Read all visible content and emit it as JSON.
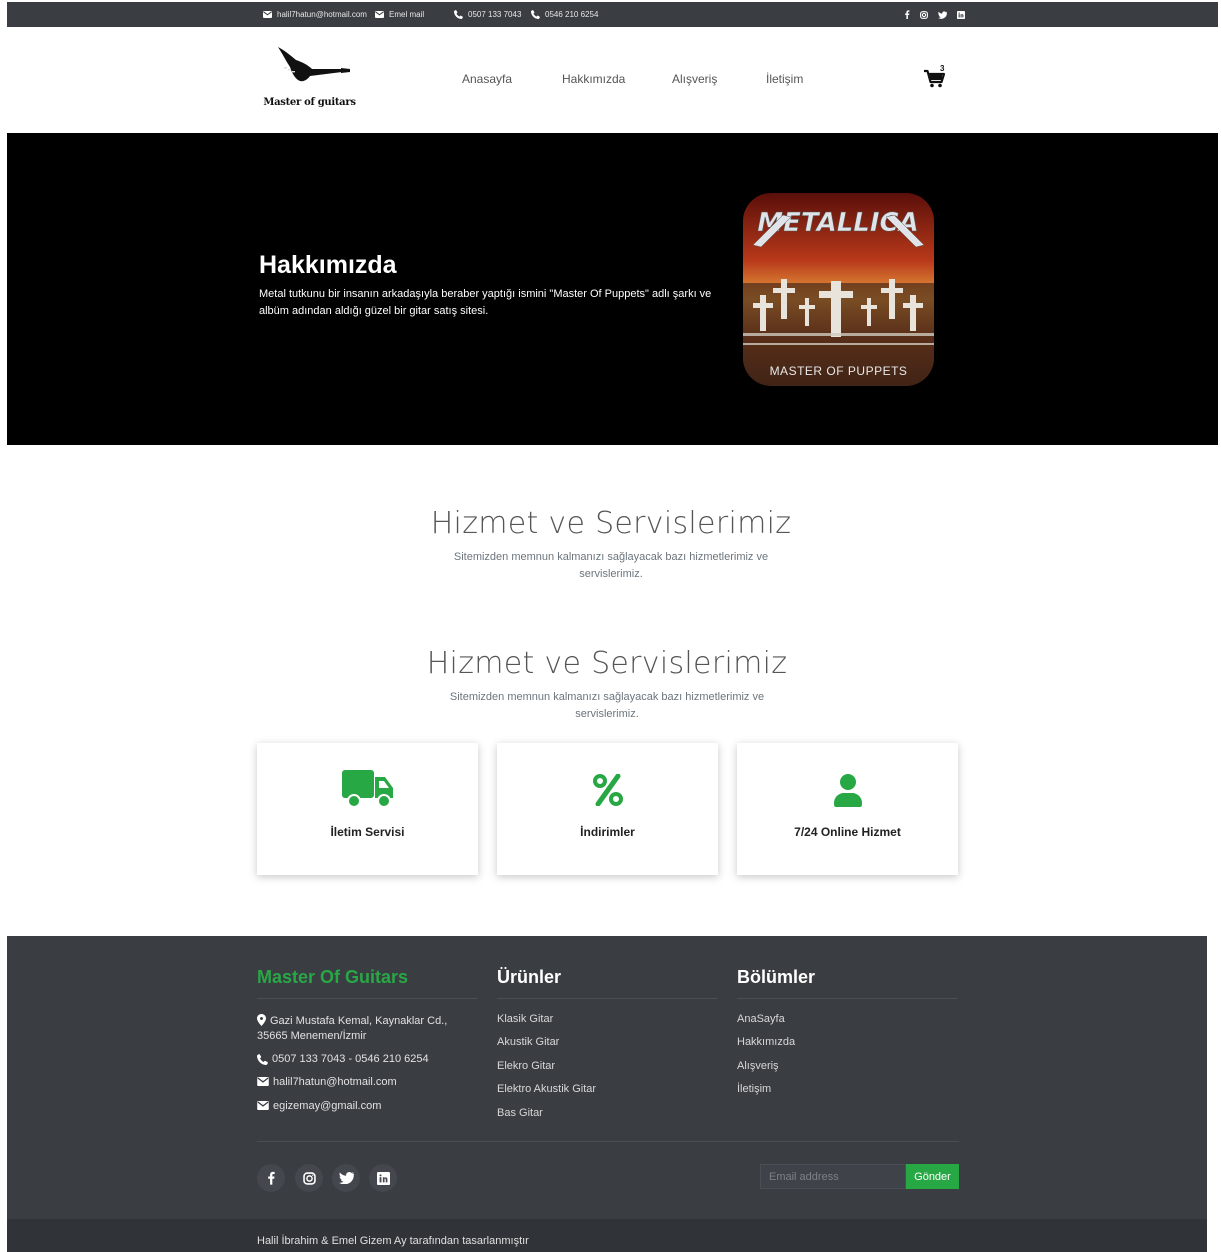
{
  "topbar": {
    "email1": "halil7hatun@hotmail.com",
    "email2": "Emel mail",
    "phone1": "0507 133 7043",
    "phone2": "0546 210 6254",
    "social_icons": [
      "facebook-icon",
      "instagram-icon",
      "twitter-icon",
      "linkedin-icon"
    ]
  },
  "header": {
    "logo_text": "Master of guitars",
    "nav": [
      "Anasayfa",
      "Hakkımızda",
      "Alışveriş",
      "İletişim"
    ],
    "cart_count": "3"
  },
  "hero": {
    "title": "Hakkımızda",
    "text": "Metal tutkunu bir insanın arkadaşıyla beraber yaptığı ismini \"Master Of Puppets\" adlı şarkı ve albüm adından aldığı güzel bir gitar satış sitesi.",
    "album_logo": "METALLICA",
    "album_caption": "MASTER OF PUPPETS"
  },
  "services1": {
    "title": "Hizmet ve Servislerimiz",
    "subtitle": "Sitemizden memnun kalmanızı sağlayacak bazı hizmetlerimiz ve servislerimiz."
  },
  "services2": {
    "title": "Hizmet ve Servislerimiz",
    "subtitle": "Sitemizden memnun kalmanızı sağlayacak bazı hizmetlerimiz ve servislerimiz.",
    "cards": [
      {
        "icon": "truck-icon",
        "label": "İletim Servisi"
      },
      {
        "icon": "percent-icon",
        "label": "İndirimler"
      },
      {
        "icon": "user-icon",
        "label": "7/24 Online Hizmet"
      }
    ],
    "accent": "#28a745"
  },
  "footer": {
    "brand": "Master Of Guitars",
    "address": "Gazi Mustafa Kemal, Kaynaklar Cd., 35665 Menemen/İzmir",
    "address_line1": "Gazi Mustafa Kemal, Kaynaklar Cd.,",
    "address_line2": "35665 Menemen/İzmir",
    "phones": "0507 133 7043 - 0546 210 6254",
    "email1": "halil7hatun@hotmail.com",
    "email2": "egizemay@gmail.com",
    "products_title": "Ürünler",
    "products": [
      "Klasik Gitar",
      "Akustik Gitar",
      "Elekro Gitar",
      "Elektro Akustik Gitar",
      "Bas Gitar"
    ],
    "sections_title": "Bölümler",
    "sections": [
      "AnaSayfa",
      "Hakkımızda",
      "Alışveriş",
      "İletişim"
    ],
    "email_placeholder": "Email address",
    "send_label": "Gönder",
    "credit": "Halil İbrahim & Emel Gizem Ay tarafından tasarlanmıştır"
  },
  "colors": {
    "dark": "#3a3d42",
    "green": "#28a745",
    "hero_bg": "#000000"
  }
}
